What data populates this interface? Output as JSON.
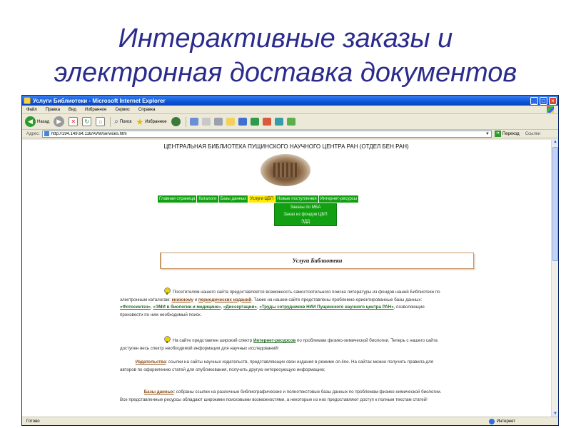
{
  "slide": {
    "title_line1": "Интерактивные заказы и",
    "title_line2": "электронная доставка документов"
  },
  "window": {
    "title": "Услуги Библиотеки - Microsoft Internet Explorer",
    "minimize": "_",
    "maximize": "□",
    "close": "×"
  },
  "menu": {
    "items": [
      "Файл",
      "Правка",
      "Вид",
      "Избранное",
      "Сервис",
      "Справка"
    ]
  },
  "toolbar": {
    "back": "Назад",
    "search": "Поиск",
    "favorites": "Избранное"
  },
  "address": {
    "label": "Адрес:",
    "url": "http://194.149.64.116/AVM/services.htm",
    "go": "Переход",
    "links": "Ссылки"
  },
  "page": {
    "header": "ЦЕНТРАЛЬНАЯ БИБЛИОТЕКА ПУЩИНСКОГО НАУЧНОГО ЦЕНТРА РАН (ОТДЕЛ БЕН РАН)",
    "nav": [
      "Главная страница",
      "Каталоги",
      "Базы данных",
      "Услуги ЦБП",
      "Новые поступления",
      "Интернет-ресурсы"
    ],
    "submenu": [
      "Заказы по МБА",
      "Заказ из фондов ЦБП",
      "ЭДД"
    ],
    "banner": "Услуги Библиотеки",
    "p1": {
      "t1": "Посетителям нашего сайта предоставляется возможность самостоятельного поиска литературы из фондов нашей Библиотеки по электронным каталогам:",
      "l1": "книжному",
      "t2": "и",
      "l2": "периодических изданий",
      "t3": ". Также на нашем сайте представлены проблемно-ориентированные базы данных:",
      "l3": "«Фотосинтез»",
      "l4": "«ЭМИ в биологии и медицине»",
      "l5": "«Диссертации»",
      "l6": "«Труды сотрудников НИИ Пущинского научного центра РАН»",
      "t4": ", позволяющие произвести по ним необходимый поиск."
    },
    "p2": {
      "t1": "На сайте представлен широкий спектр",
      "l1": "Интернет-ресурсов",
      "t2": "по проблемам физико-химической биологии. Теперь с нашего сайта доступен весь спектр необходимой информации для научных исследований!"
    },
    "p3": {
      "l1": "Издательства",
      "t1": ": ссылки на сайты научных издательств, представляющих свои издания в режиме on-line. На сайтах можно получить правила для авторов по оформлению статей для опубликования, получить другую интересующую информацию;"
    },
    "p4": {
      "l1": "Базы данных",
      "t1": ": собраны ссылки на различные библиографические и полнотекстовые базы данных по проблемам физико-химической биологии. Все представленные ресурсы обладают широкими поисковыми возможностями, а некоторые из них предоставляют доступ к полным текстам статей!"
    }
  },
  "status": {
    "left": "Готово",
    "zone": "Интернет"
  }
}
